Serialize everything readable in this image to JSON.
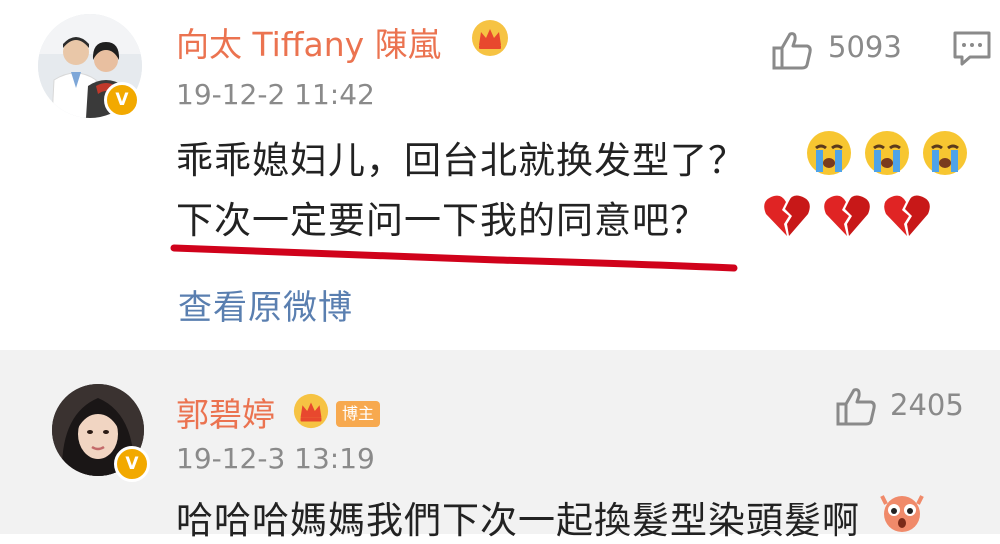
{
  "comment1": {
    "username": "向太 Tiffany 陳嵐",
    "timestamp": "19-12-2 11:42",
    "likes": "5093",
    "verified_badge": "V",
    "icons": [
      "crown-icon",
      "thumb-up-icon",
      "comment-icon",
      "crying-emoji",
      "broken-heart-emoji"
    ],
    "line1": "乖乖媳妇儿，回台北就换发型了？",
    "line2": "下次一定要问一下我的同意吧？",
    "view_original": "查看原微博",
    "underline_color": "#d0021b"
  },
  "comment2": {
    "username": "郭碧婷",
    "tag": "博主",
    "timestamp": "19-12-3 13:19",
    "likes": "2405",
    "verified_badge": "V",
    "text": "哈哈哈媽媽我們下次一起換髮型染頭髮啊"
  },
  "colors": {
    "username": "#eb7350",
    "link": "#5a7fb0",
    "meta": "#8a8a8a",
    "badge": "#f2a900",
    "tag": "#f7a94f"
  }
}
